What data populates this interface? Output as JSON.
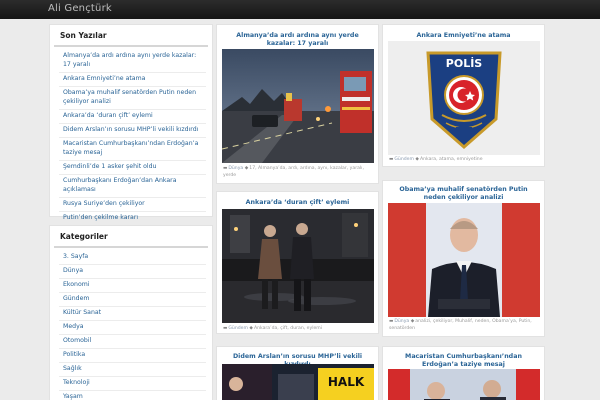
{
  "site": {
    "title": "Ali Gençtürk"
  },
  "recent": {
    "heading": "Son Yazılar",
    "items": [
      "Almanya’da ardı ardına aynı yerde kazalar: 17 yaralı",
      "Ankara Emniyeti’ne atama",
      "Obama’ya muhalif senatörden Putin neden çekiliyor analizi",
      "Ankara’da ‘duran çift’ eylemi",
      "Didem Arslan’ın sorusu MHP’li vekili kızdırdı",
      "Macaristan Cumhurbaşkanı’ndan Erdoğan’a taziye mesaj",
      "Şemdinli’de 1 asker şehit oldu",
      "Cumhurbaşkanı Erdoğan’dan Ankara açıklaması",
      "Rusya Suriye’den çekiliyor",
      "Putin’den çekilme kararı"
    ]
  },
  "categories": {
    "heading": "Kategoriler",
    "items": [
      "3. Sayfa",
      "Dünya",
      "Ekonomi",
      "Gündem",
      "Kültür Sanat",
      "Medya",
      "Otomobil",
      "Politika",
      "Sağlık",
      "Teknoloji",
      "Yaşam"
    ]
  },
  "posts": [
    {
      "title": "Almanya’da ardı ardına aynı yerde kazalar: 17 yaralı",
      "category": "Dünya",
      "tags": "17, Almanya’da, ardı, ardına, aynı, kazalar, yaralı, yerde"
    },
    {
      "title": "Ankara Emniyeti’ne atama",
      "category": "Gündem",
      "tags": "Ankara, atama, emniyetine"
    },
    {
      "title": "Ankara’da ‘duran çift’ eylemi",
      "category": "Gündem",
      "tags": "Ankara’da, çift, duran, eylemi"
    },
    {
      "title": "Obama’ya muhalif senatörden Putin neden çekiliyor analizi",
      "category": "Dünya",
      "tags": "analizi, çekiliyor, Muhalif, neden, Obama’ya, Putin, senatörden"
    },
    {
      "title": "Didem Arslan’ın sorusu MHP’li vekili kızdırdı"
    },
    {
      "title": "Macaristan Cumhurbaşkanı’ndan Erdoğan’a taziye mesaj"
    }
  ],
  "badge": {
    "text": "POLİS"
  },
  "banner": {
    "text": "HALK"
  },
  "icons": {
    "folder": "folder-icon",
    "tag": "tag-icon"
  },
  "colors": {
    "link": "#2a6496",
    "topbar": "#1f1f1f",
    "background": "#ebebeb"
  }
}
